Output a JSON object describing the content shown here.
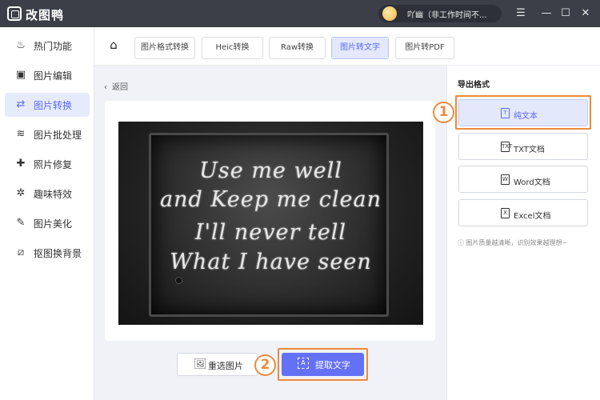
{
  "app": {
    "title": "改图鸭",
    "user_name": "吖幽（非工作时间不..."
  },
  "window_controls": {
    "menu": "☰",
    "minimize": "—",
    "maximize": "☐",
    "close": "✕"
  },
  "sidebar": {
    "items": [
      {
        "label": "热门功能",
        "icon": "flame-icon",
        "glyph": "♨"
      },
      {
        "label": "图片编辑",
        "icon": "image-edit-icon",
        "glyph": "▣"
      },
      {
        "label": "图片转换",
        "icon": "convert-icon",
        "glyph": "⇄"
      },
      {
        "label": "图片批处理",
        "icon": "batch-icon",
        "glyph": "≋"
      },
      {
        "label": "照片修复",
        "icon": "photo-repair-icon",
        "glyph": "✚"
      },
      {
        "label": "趣味特效",
        "icon": "sparkle-icon",
        "glyph": "✲"
      },
      {
        "label": "图片美化",
        "icon": "beautify-icon",
        "glyph": "✎"
      },
      {
        "label": "抠图换背景",
        "icon": "cutout-icon",
        "glyph": "⧄"
      }
    ],
    "active_index": 2
  },
  "tabs": {
    "home_icon": "⌂",
    "items": [
      {
        "label": "图片格式转换"
      },
      {
        "label": "Heic转换"
      },
      {
        "label": "Raw转换"
      },
      {
        "label": "图片转文字"
      },
      {
        "label": "图片转PDF"
      }
    ],
    "active_index": 3
  },
  "main": {
    "back_arrow": "‹",
    "back_label": "返回",
    "image_text_lines": [
      "Use me well",
      "and Keep me clean",
      "I'll never tell",
      "What I have seen"
    ],
    "reselect_icon": "🖼",
    "reselect_label": "重选图片",
    "extract_icon": "A",
    "extract_label": "提取文字"
  },
  "export": {
    "title": "导出格式",
    "formats": [
      {
        "label": "纯文本",
        "icon_text": "T"
      },
      {
        "label": "TXT文档",
        "icon_text": "TXT"
      },
      {
        "label": "Word文档",
        "icon_text": "W"
      },
      {
        "label": "Excel文档",
        "icon_text": "X"
      }
    ],
    "active_index": 0,
    "hint": "ⓘ 图片质量越清晰，识别效果越理想~"
  },
  "annotations": {
    "step1": "1",
    "step2": "2"
  },
  "colors": {
    "accent": "#6471f5",
    "highlight": "#ed8a3d",
    "titlebar": "#3c3f47"
  }
}
